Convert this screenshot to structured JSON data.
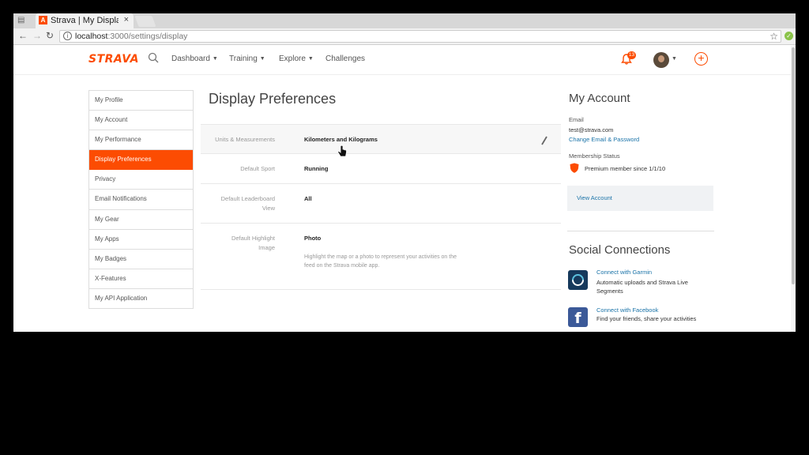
{
  "browser": {
    "tab_title": "Strava | My Display",
    "tab_close": "×",
    "url_host": "localhost",
    "url_path": ":3000/settings/display"
  },
  "header": {
    "logo": "STRAVA",
    "nav": {
      "dashboard": "Dashboard",
      "training": "Training",
      "explore": "Explore",
      "challenges": "Challenges"
    },
    "notification_count": "13",
    "plus": "+"
  },
  "sidebar": {
    "items": [
      {
        "label": "My Profile"
      },
      {
        "label": "My Account"
      },
      {
        "label": "My Performance"
      },
      {
        "label": "Display Preferences"
      },
      {
        "label": "Privacy"
      },
      {
        "label": "Email Notifications"
      },
      {
        "label": "My Gear"
      },
      {
        "label": "My Apps"
      },
      {
        "label": "My Badges"
      },
      {
        "label": "X-Features"
      },
      {
        "label": "My API Application"
      }
    ],
    "active_index": 3
  },
  "main": {
    "title": "Display Preferences",
    "rows": [
      {
        "label": "Units & Measurements",
        "value": "Kilometers and Kilograms"
      },
      {
        "label": "Default Sport",
        "value": "Running"
      },
      {
        "label": "Default Leaderboard View",
        "value": "All"
      },
      {
        "label": "Default Highlight Image",
        "value": "Photo",
        "help": "Highlight the map or a photo to represent your activities on the feed on the Strava mobile app."
      }
    ]
  },
  "account": {
    "heading": "My Account",
    "email_label": "Email",
    "email": "test@strava.com",
    "change_link": "Change Email & Password",
    "membership_label": "Membership Status",
    "membership": "Premium member since 1/1/10",
    "view_account": "View Account"
  },
  "social": {
    "heading": "Social Connections",
    "garmin_link": "Connect with Garmin",
    "garmin_desc": "Automatic uploads and Strava Live Segments",
    "facebook_link": "Connect with Facebook",
    "facebook_desc": "Find your friends, share your activities",
    "facebook_glyph": "f"
  },
  "colors": {
    "brand": "#fc4c02",
    "link": "#1a73a8"
  }
}
